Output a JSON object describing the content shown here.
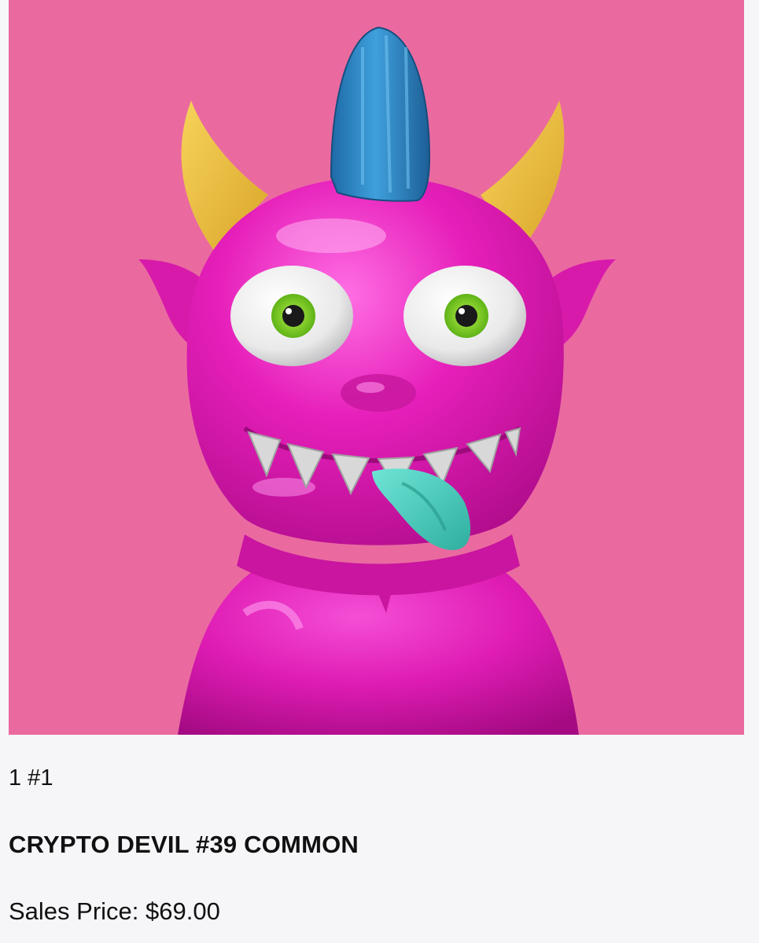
{
  "item": {
    "edition": "1 #1",
    "title": "CRYPTO DEVIL #39 COMMON",
    "price_text": "Sales Price: $69.00"
  },
  "artwork": {
    "background_color": "#ea6aa0",
    "body_color": "#e61fba",
    "mohawk_color": "#2f86c4",
    "horn_color": "#ecbd3d",
    "tongue_color": "#4fd0c0",
    "iris_color": "#7ed321"
  }
}
